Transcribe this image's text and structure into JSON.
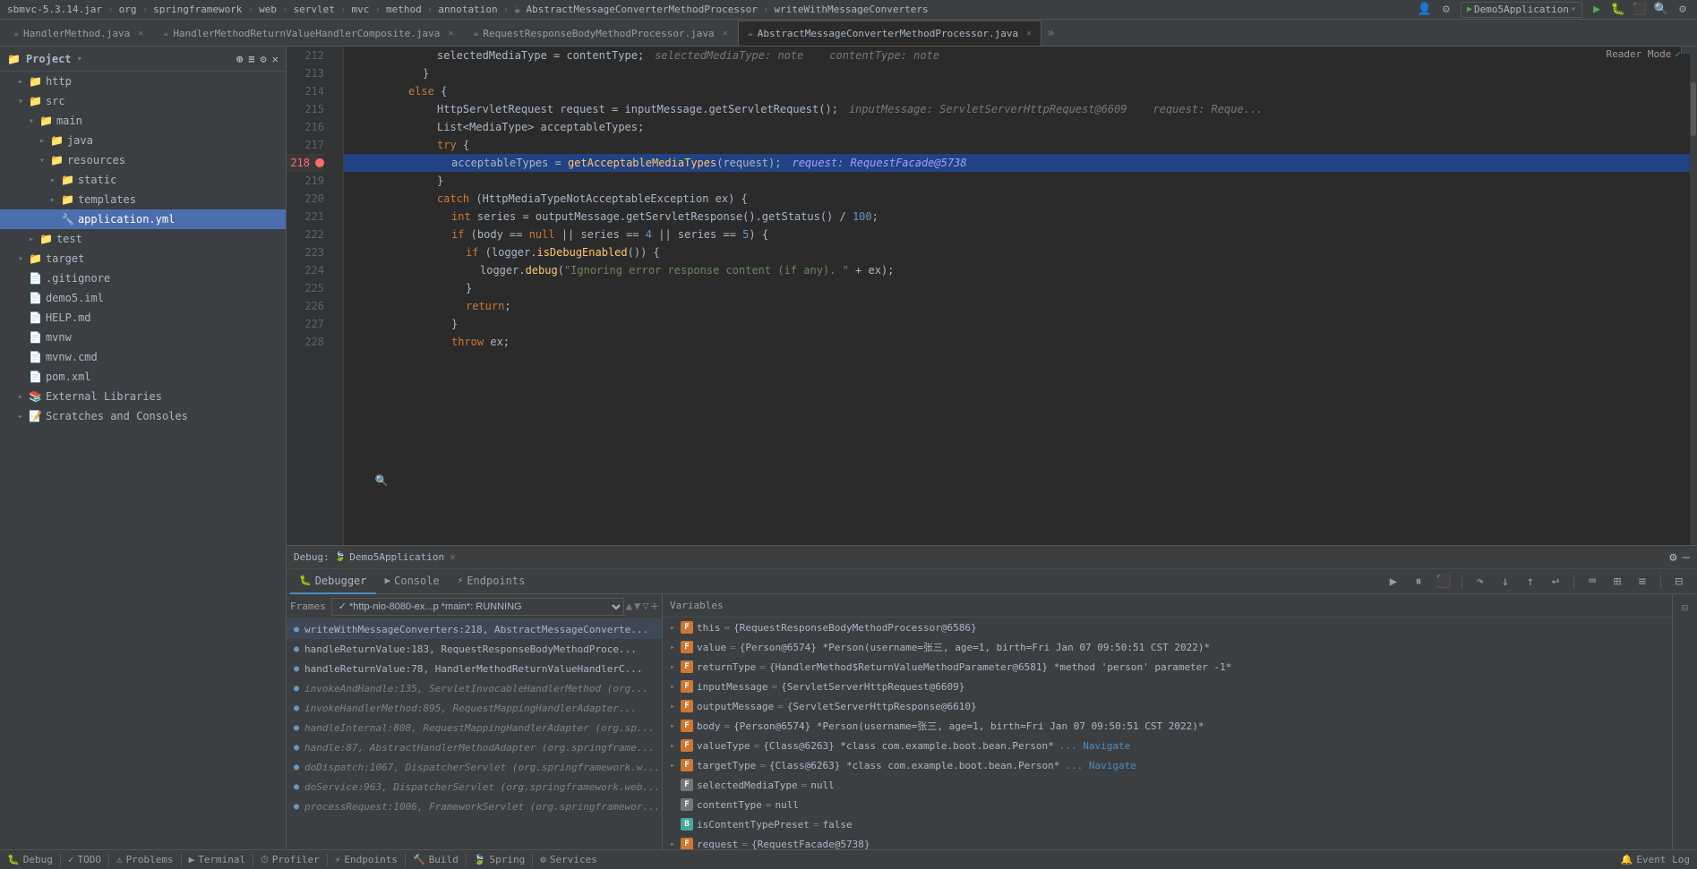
{
  "topbar": {
    "breadcrumbs": [
      "sbmvc-5.3.14.jar",
      "org",
      "springframework",
      "web",
      "servlet",
      "mvc",
      "method",
      "annotation",
      "AbstractMessageConverterMethodProcessor",
      "writeWithMessageConverters"
    ],
    "icons_right": [
      "user-icon",
      "search-icon",
      "settings-icon",
      "run-dropdown",
      "run-icon",
      "stop-icon",
      "gear-icon",
      "search-icon-2",
      "settings-icon-2"
    ]
  },
  "tabs": [
    {
      "label": "HandlerMethod.java",
      "active": false,
      "icon": "☕"
    },
    {
      "label": "HandlerMethodReturnValueHandlerComposite.java",
      "active": false,
      "icon": "☕"
    },
    {
      "label": "RequestResponseBodyMethodProcessor.java",
      "active": false,
      "icon": "☕"
    },
    {
      "label": "AbstractMessageConverterMethodProcessor.java",
      "active": true,
      "icon": "☕"
    }
  ],
  "reader_mode": "Reader Mode",
  "sidebar": {
    "title": "Project",
    "tree": [
      {
        "indent": 0,
        "expanded": true,
        "icon": "📁",
        "label": "http",
        "selected": false
      },
      {
        "indent": 0,
        "expanded": true,
        "icon": "📁",
        "label": "src",
        "selected": false
      },
      {
        "indent": 1,
        "expanded": true,
        "icon": "📁",
        "label": "main",
        "selected": false
      },
      {
        "indent": 2,
        "expanded": false,
        "icon": "📁",
        "label": "java",
        "selected": false
      },
      {
        "indent": 2,
        "expanded": true,
        "icon": "📁",
        "label": "resources",
        "selected": false
      },
      {
        "indent": 3,
        "expanded": false,
        "icon": "📁",
        "label": "static",
        "selected": false
      },
      {
        "indent": 3,
        "expanded": false,
        "icon": "📁",
        "label": "templates",
        "selected": false
      },
      {
        "indent": 3,
        "expanded": false,
        "icon": "🔧",
        "label": "application.yml",
        "selected": true
      },
      {
        "indent": 1,
        "expanded": false,
        "icon": "📁",
        "label": "test",
        "selected": false
      },
      {
        "indent": 0,
        "expanded": true,
        "icon": "📁",
        "label": "target",
        "selected": false
      },
      {
        "indent": 0,
        "expanded": false,
        "icon": "📄",
        "label": ".gitignore",
        "selected": false
      },
      {
        "indent": 0,
        "expanded": false,
        "icon": "📄",
        "label": "demo5.iml",
        "selected": false
      },
      {
        "indent": 0,
        "expanded": false,
        "icon": "📄",
        "label": "HELP.md",
        "selected": false
      },
      {
        "indent": 0,
        "expanded": false,
        "icon": "📄",
        "label": "mvnw",
        "selected": false
      },
      {
        "indent": 0,
        "expanded": false,
        "icon": "📄",
        "label": "mvnw.cmd",
        "selected": false
      },
      {
        "indent": 0,
        "expanded": false,
        "icon": "📄",
        "label": "pom.xml",
        "selected": false
      },
      {
        "indent": 0,
        "expanded": false,
        "icon": "📚",
        "label": "External Libraries",
        "selected": false
      },
      {
        "indent": 0,
        "expanded": false,
        "icon": "📝",
        "label": "Scratches and Consoles",
        "selected": false
      }
    ]
  },
  "code": {
    "lines": [
      {
        "num": 212,
        "content": "            selectedMediaType = contentType;    ",
        "hint": "selectedMediaType: note   contentType: note"
      },
      {
        "num": 213,
        "content": "        }"
      },
      {
        "num": 214,
        "content": "        else {"
      },
      {
        "num": 215,
        "content": "            HttpServletRequest request = inputMessage.getServletRequest();",
        "hint": "inputMessage: ServletServerHttpRequest@6609   request: Reque"
      },
      {
        "num": 216,
        "content": "            List<MediaType> acceptableTypes;"
      },
      {
        "num": 217,
        "content": "            try {"
      },
      {
        "num": 218,
        "content": "                acceptableTypes = getAcceptableMediaTypes(request);",
        "hint": "request: RequestFacade@5738",
        "highlighted": true,
        "breakpoint": true
      },
      {
        "num": 219,
        "content": "            }"
      },
      {
        "num": 220,
        "content": "            catch (HttpMediaTypeNotAcceptableException ex) {"
      },
      {
        "num": 221,
        "content": "                int series = outputMessage.getServletResponse().getStatus() / 100;"
      },
      {
        "num": 222,
        "content": "                if (body == null || series == 4 || series == 5) {"
      },
      {
        "num": 223,
        "content": "                    if (logger.isDebugEnabled()) {"
      },
      {
        "num": 224,
        "content": "                        logger.debug(\"Ignoring error response content (if any). \" + ex);"
      },
      {
        "num": 225,
        "content": "                    }"
      },
      {
        "num": 226,
        "content": "                    return;"
      },
      {
        "num": 227,
        "content": "                }"
      },
      {
        "num": 228,
        "content": "                throw ex;"
      }
    ]
  },
  "debug": {
    "section_label": "Debug:",
    "app_name": "Demo5Application",
    "tabs": [
      {
        "label": "Debugger",
        "icon": "🐛",
        "active": true
      },
      {
        "label": "Console",
        "icon": "▶",
        "active": false
      },
      {
        "label": "Endpoints",
        "icon": "⚡",
        "active": false
      }
    ],
    "toolbar_buttons": [
      "resume",
      "pause",
      "stop",
      "step-over",
      "step-into",
      "step-out",
      "run-to-cursor",
      "evaluate",
      "grid",
      "more"
    ],
    "frames_header": "Frames",
    "thread_selector": "✓ *http-nio-8080-ex...p *main*: RUNNING",
    "frames": [
      {
        "label": "writeWithMessageConverters:218, AbstractMessageConverte...",
        "selected": true,
        "check": false
      },
      {
        "label": "handleReturnValue:183, RequestResponseBodyMethodProce...",
        "selected": false
      },
      {
        "label": "handleReturnValue:78, HandlerMethodReturnValueHandlerC...",
        "selected": false
      },
      {
        "label": "invokeAndHandle:135, ServletInvocableHandlerMethod (org...",
        "selected": false
      },
      {
        "label": "invokeHandlerMethod:895, RequestMappingHandlerAdapter...",
        "selected": false
      },
      {
        "label": "handleInternal:808, RequestMappingHandlerAdapter (org.sp...",
        "selected": false
      },
      {
        "label": "handle:87, AbstractHandlerMethodAdapter (org.springframe...",
        "selected": false
      },
      {
        "label": "doDispatch:1067, DispatcherServlet (org.springframework.w...",
        "selected": false
      },
      {
        "label": "doService:963, DispatcherServlet (org.springframework.web...",
        "selected": false
      },
      {
        "label": "processRequest:1006, FrameworkServlet (org.springframewor...",
        "selected": false
      }
    ],
    "variables_header": "Variables",
    "variables": [
      {
        "expand": true,
        "icon": "F",
        "icon_color": "orange",
        "name": "this",
        "eq": "=",
        "val": "{RequestResponseBodyMethodProcessor@6586}"
      },
      {
        "expand": true,
        "icon": "F",
        "icon_color": "orange",
        "name": "value",
        "eq": "=",
        "val": "{Person@6574} *Person(username=张三, age=1, birth=Fri Jan 07 09:50:51 CST 2022)*"
      },
      {
        "expand": true,
        "icon": "F",
        "icon_color": "orange",
        "name": "returnType",
        "eq": "=",
        "val": "{HandlerMethod$ReturnValueMethodParameter@6581} *method 'person' parameter -1*"
      },
      {
        "expand": true,
        "icon": "F",
        "icon_color": "orange",
        "name": "inputMessage",
        "eq": "=",
        "val": "{ServletServerHttpRequest@6609}"
      },
      {
        "expand": true,
        "icon": "F",
        "icon_color": "orange",
        "name": "outputMessage",
        "eq": "=",
        "val": "{ServletServerHttpResponse@6610}"
      },
      {
        "expand": true,
        "icon": "F",
        "icon_color": "orange",
        "name": "body",
        "eq": "=",
        "val": "{Person@6574} *Person(username=张三, age=1, birth=Fri Jan 07 09:50:51 CST 2022)*"
      },
      {
        "expand": true,
        "icon": "F",
        "icon_color": "orange",
        "name": "valueType",
        "eq": "=",
        "val": "{Class@6263} *class com.example.boot.bean.Person*",
        "navigate": "Navigate"
      },
      {
        "expand": true,
        "icon": "F",
        "icon_color": "orange",
        "name": "targetType",
        "eq": "=",
        "val": "{Class@6263} *class com.example.boot.bean.Person*",
        "navigate": "Navigate"
      },
      {
        "expand": false,
        "icon": "F",
        "icon_color": "gray",
        "name": "selectedMediaType",
        "eq": "=",
        "val": "null"
      },
      {
        "expand": false,
        "icon": "F",
        "icon_color": "gray",
        "name": "contentType",
        "eq": "=",
        "val": "null"
      },
      {
        "expand": false,
        "icon": "F",
        "icon_color": "teal",
        "name": "isContentTypePreset",
        "eq": "=",
        "val": "false"
      },
      {
        "expand": true,
        "icon": "F",
        "icon_color": "orange",
        "name": "request",
        "eq": "=",
        "val": "{RequestFacade@5738}"
      }
    ]
  },
  "statusbar": {
    "items": [
      {
        "icon": "🐛",
        "label": "Debug"
      },
      {
        "icon": "✓",
        "label": "TODO"
      },
      {
        "icon": "⚠",
        "label": "Problems"
      },
      {
        "icon": "▶",
        "label": "Terminal"
      },
      {
        "icon": "⏱",
        "label": "Profiler"
      },
      {
        "icon": "⚡",
        "label": "Endpoints"
      },
      {
        "icon": "🔨",
        "label": "Build"
      },
      {
        "icon": "🍃",
        "label": "Spring"
      },
      {
        "icon": "⚙",
        "label": "Services"
      }
    ],
    "right": "Event Log"
  }
}
